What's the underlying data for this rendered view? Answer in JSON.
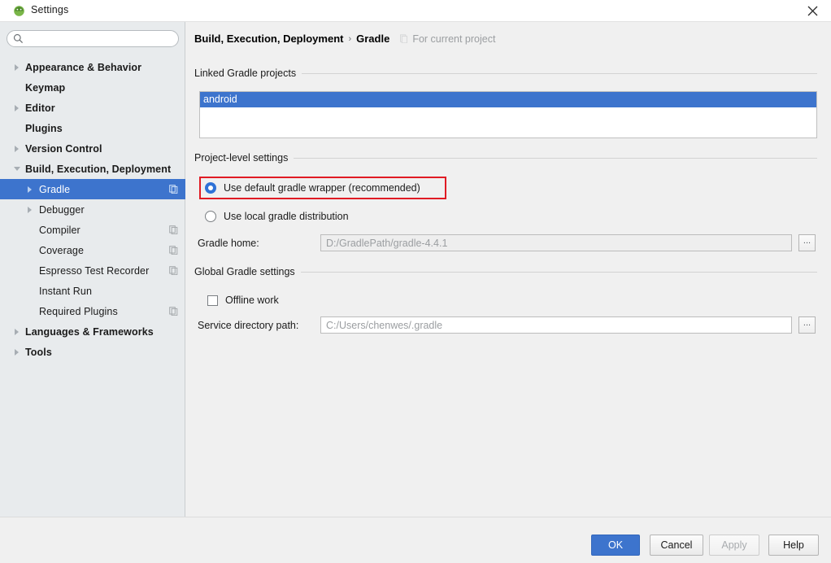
{
  "window": {
    "title": "Settings",
    "app_icon": "android-studio-icon",
    "close_label": "close-icon"
  },
  "sidebar": {
    "search": {
      "value": "",
      "placeholder": "",
      "icon": "search-icon"
    },
    "items": [
      {
        "label": "Appearance & Behavior",
        "level": 0,
        "arrow": "right",
        "selected": false,
        "copy_icon": false
      },
      {
        "label": "Keymap",
        "level": 0,
        "arrow": "none",
        "selected": false,
        "copy_icon": false
      },
      {
        "label": "Editor",
        "level": 0,
        "arrow": "right",
        "selected": false,
        "copy_icon": false
      },
      {
        "label": "Plugins",
        "level": 0,
        "arrow": "none",
        "selected": false,
        "copy_icon": false
      },
      {
        "label": "Version Control",
        "level": 0,
        "arrow": "right",
        "selected": false,
        "copy_icon": false
      },
      {
        "label": "Build, Execution, Deployment",
        "level": 0,
        "arrow": "down",
        "selected": false,
        "copy_icon": false
      },
      {
        "label": "Gradle",
        "level": 1,
        "arrow": "right",
        "selected": true,
        "copy_icon": true
      },
      {
        "label": "Debugger",
        "level": 1,
        "arrow": "right",
        "selected": false,
        "copy_icon": false
      },
      {
        "label": "Compiler",
        "level": 1,
        "arrow": "none",
        "selected": false,
        "copy_icon": true
      },
      {
        "label": "Coverage",
        "level": 1,
        "arrow": "none",
        "selected": false,
        "copy_icon": true
      },
      {
        "label": "Espresso Test Recorder",
        "level": 1,
        "arrow": "none",
        "selected": false,
        "copy_icon": true
      },
      {
        "label": "Instant Run",
        "level": 1,
        "arrow": "none",
        "selected": false,
        "copy_icon": false
      },
      {
        "label": "Required Plugins",
        "level": 1,
        "arrow": "none",
        "selected": false,
        "copy_icon": true
      },
      {
        "label": "Languages & Frameworks",
        "level": 0,
        "arrow": "right",
        "selected": false,
        "copy_icon": false
      },
      {
        "label": "Tools",
        "level": 0,
        "arrow": "right",
        "selected": false,
        "copy_icon": false
      }
    ]
  },
  "content": {
    "breadcrumb": {
      "parent": "Build, Execution, Deployment",
      "separator": "›",
      "current": "Gradle",
      "scope_icon": "project-scope-icon",
      "scope_text": "For current project"
    },
    "linked_projects": {
      "group_label": "Linked Gradle projects",
      "items": [
        {
          "label": "android",
          "selected": true
        }
      ]
    },
    "project_level": {
      "group_label": "Project-level settings",
      "radios": [
        {
          "label": "Use default gradle wrapper (recommended)",
          "checked": true,
          "highlighted": true
        },
        {
          "label": "Use local gradle distribution",
          "checked": false,
          "highlighted": false
        }
      ],
      "gradle_home": {
        "label": "Gradle home:",
        "value": "D:/GradlePath/gradle-4.4.1",
        "enabled": false,
        "browse_label": "..."
      }
    },
    "global_settings": {
      "group_label": "Global Gradle settings",
      "offline_work": {
        "label": "Offline work",
        "checked": false
      },
      "service_directory": {
        "label": "Service directory path:",
        "value": "C:/Users/chenwes/.gradle",
        "enabled": true,
        "browse_label": "..."
      }
    }
  },
  "footer": {
    "buttons": [
      {
        "label": "OK",
        "style": "primary"
      },
      {
        "label": "Cancel",
        "style": "normal"
      },
      {
        "label": "Apply",
        "style": "disabled"
      },
      {
        "label": "Help",
        "style": "normal"
      }
    ]
  },
  "colors": {
    "selection_blue": "#3d74cd",
    "radio_blue": "#2f72d7",
    "annotation_red": "#e01b24",
    "sidebar_bg": "#e8ebed",
    "panel_bg": "#f0f0f0"
  }
}
